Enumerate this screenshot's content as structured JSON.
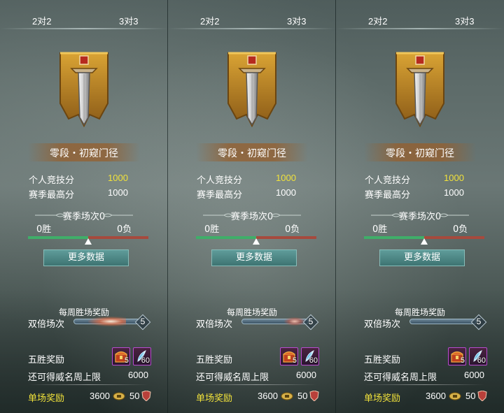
{
  "tabs": [
    "2对2",
    "3对3"
  ],
  "panels": [
    {
      "rank_name": "零段・初窥门径",
      "personal_score_label": "个人竞技分",
      "personal_score": "1000",
      "season_high_label": "赛季最高分",
      "season_high": "1000",
      "season_games": "赛季场次0",
      "wins": "0胜",
      "losses": "0负",
      "more_data": "更多数据",
      "weekly_title": "每周胜场奖励",
      "double_label": "双倍场次",
      "double_count": "5",
      "five_win_label": "五胜奖励",
      "item1_count": "5",
      "item2_count": "60",
      "prestige_label": "还可得威名周上限",
      "prestige_value": "6000",
      "single_label": "单场奖励",
      "single_coins": "3600",
      "single_prestige": "50"
    },
    {
      "rank_name": "零段・初窥门径",
      "personal_score_label": "个人竞技分",
      "personal_score": "1000",
      "season_high_label": "赛季最高分",
      "season_high": "1000",
      "season_games": "赛季场次0",
      "wins": "0胜",
      "losses": "0负",
      "more_data": "更多数据",
      "weekly_title": "每周胜场奖励",
      "double_label": "双倍场次",
      "double_count": "5",
      "five_win_label": "五胜奖励",
      "item1_count": "5",
      "item2_count": "60",
      "prestige_label": "还可得威名周上限",
      "prestige_value": "6000",
      "single_label": "单场奖励",
      "single_coins": "3600",
      "single_prestige": "50"
    },
    {
      "rank_name": "零段・初窥门径",
      "personal_score_label": "个人竞技分",
      "personal_score": "1000",
      "season_high_label": "赛季最高分",
      "season_high": "1000",
      "season_games": "赛季场次0",
      "wins": "0胜",
      "losses": "0负",
      "more_data": "更多数据",
      "weekly_title": "每周胜场奖励",
      "double_label": "双倍场次",
      "double_count": "5",
      "five_win_label": "五胜奖励",
      "item1_count": "5",
      "item2_count": "60",
      "prestige_label": "还可得威名周上限",
      "prestige_value": "6000",
      "single_label": "单场奖励",
      "single_coins": "3600",
      "single_prestige": "50"
    }
  ],
  "win_loss_marker_fraction": 0.5,
  "icons": {
    "emblem": "sword-banner-icon",
    "reward_item_1": "treasure-chest-icon",
    "reward_item_2": "blue-feather-icon",
    "coins": "coin-icon",
    "prestige": "shield-badge-icon"
  },
  "colors": {
    "highlight_yellow": "#f1e23b",
    "win_green": "#3fae69",
    "loss_red": "#a64a3d",
    "button_teal": "#4e8785"
  }
}
